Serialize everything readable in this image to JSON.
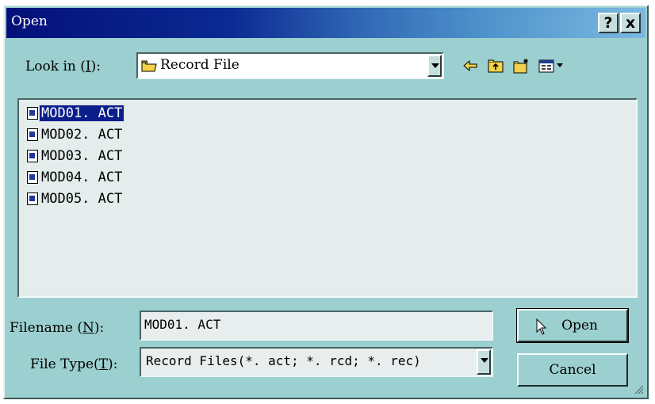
{
  "window": {
    "title": "Open"
  },
  "titlebar": {
    "help_label": "?",
    "close_label": "x"
  },
  "lookin": {
    "label_prefix": "Look in  (",
    "label_key": "I",
    "label_suffix": "):",
    "value": "Record File"
  },
  "toolbar": {
    "icons": [
      "back-arrow-icon",
      "up-folder-icon",
      "new-folder-icon",
      "view-menu-icon"
    ]
  },
  "files": [
    {
      "name": "MOD01. ACT",
      "selected": true
    },
    {
      "name": "MOD02. ACT",
      "selected": false
    },
    {
      "name": "MOD03. ACT",
      "selected": false
    },
    {
      "name": "MOD04. ACT",
      "selected": false
    },
    {
      "name": "MOD05. ACT",
      "selected": false
    }
  ],
  "filename": {
    "label_prefix": "Filename (",
    "label_key": "N",
    "label_suffix": "):",
    "value": "MOD01. ACT"
  },
  "filetype": {
    "label_prefix": "File Type(",
    "label_key": "T",
    "label_suffix": "):",
    "value": "Record Files(*. act; *. rcd; *. rec)"
  },
  "buttons": {
    "open_label": "Open",
    "cancel_label": "Cancel"
  },
  "colors": {
    "dialog_bg": "#9ccfcf",
    "selection": "#0a1e8c",
    "titlebar_start": "#04107a"
  }
}
